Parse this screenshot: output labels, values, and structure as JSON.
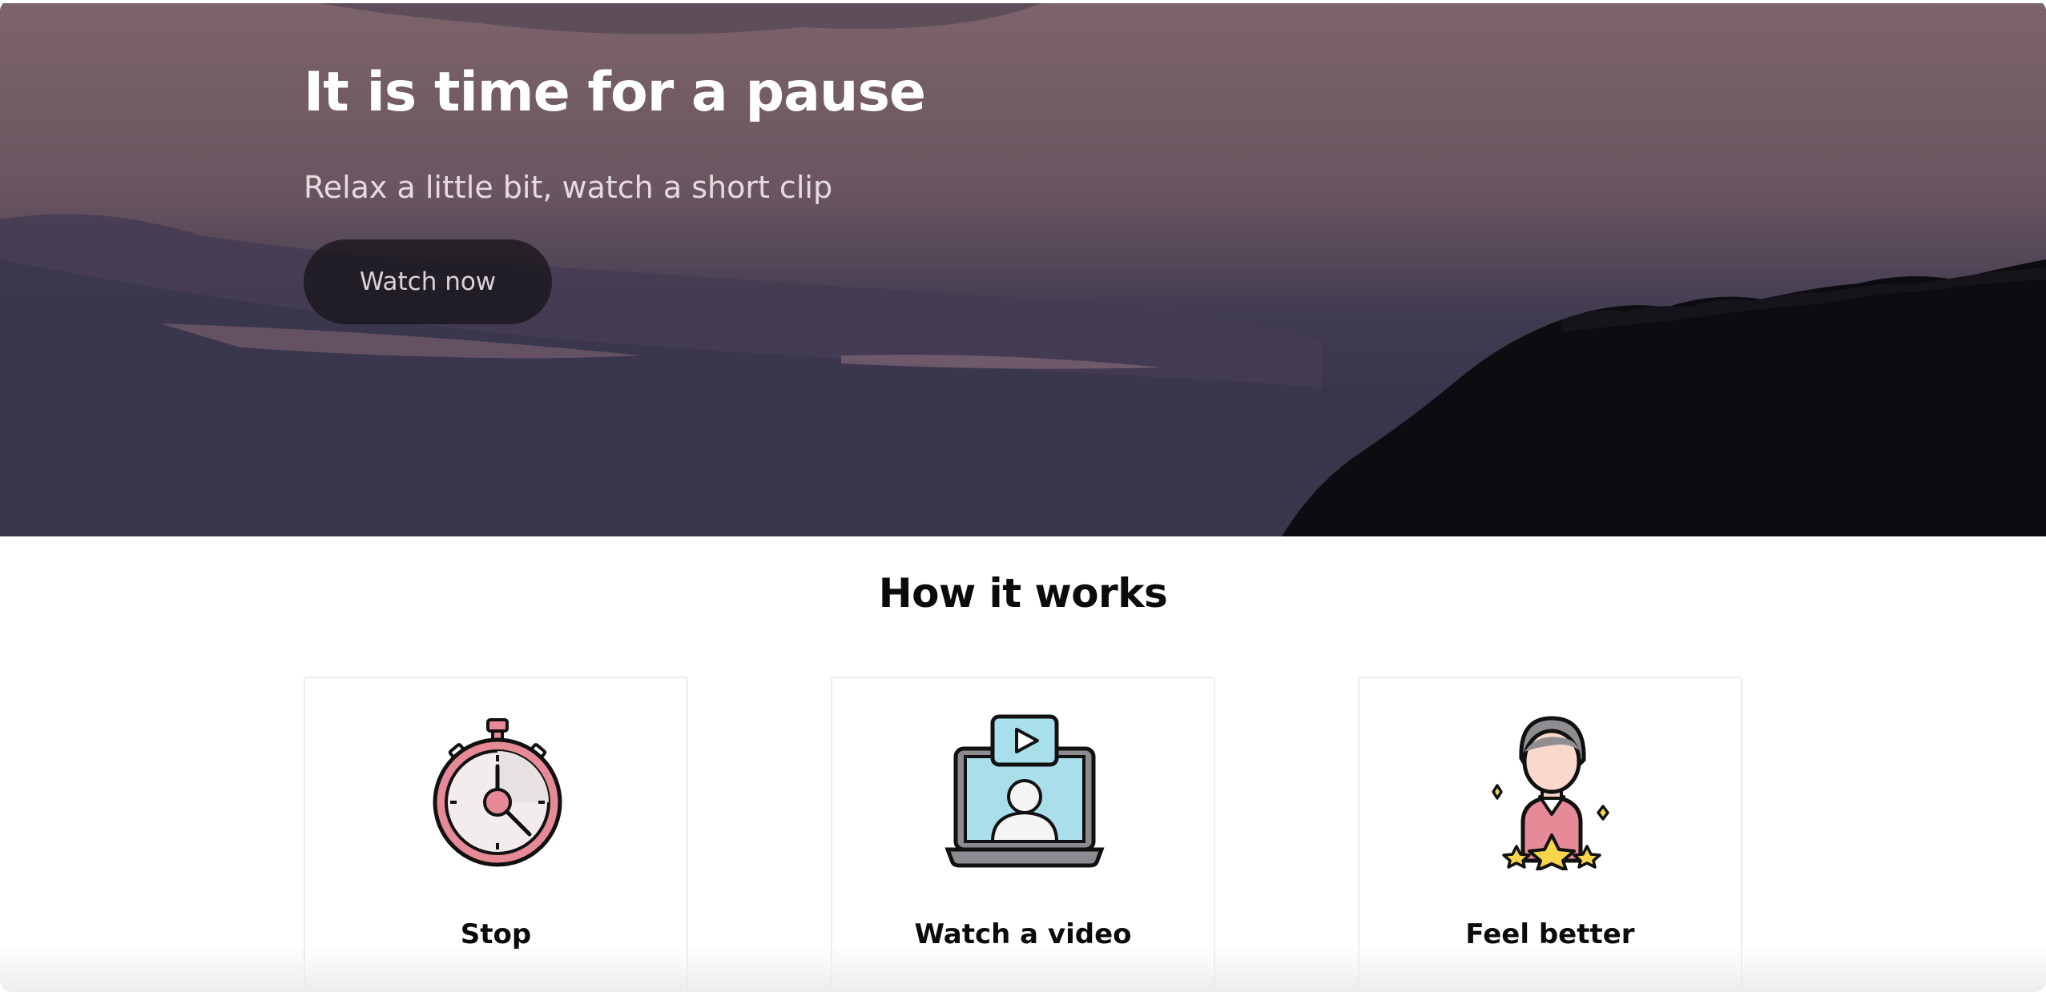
{
  "hero": {
    "title": "It is time for a pause",
    "subtitle": "Relax a little bit, watch a short clip",
    "button_label": "Watch now"
  },
  "how_it_works": {
    "title": "How it works",
    "cards": [
      {
        "label": "Stop",
        "icon": "stopwatch-icon"
      },
      {
        "label": "Watch a video",
        "icon": "laptop-video-icon"
      },
      {
        "label": "Feel better",
        "icon": "happy-person-icon"
      }
    ]
  },
  "colors": {
    "accent_pink": "#e58a96",
    "icon_blue": "#a9dfea",
    "icon_yellow": "#f7d54d",
    "button_bg": "#1a171c"
  }
}
